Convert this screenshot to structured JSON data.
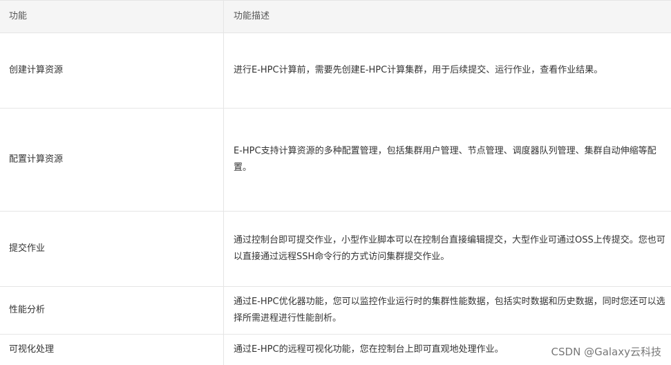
{
  "table": {
    "header": {
      "feature": "功能",
      "description": "功能描述"
    },
    "rows": [
      {
        "feature": "创建计算资源",
        "description": "进行E-HPC计算前，需要先创建E-HPC计算集群，用于后续提交、运行作业，查看作业结果。"
      },
      {
        "feature": "配置计算资源",
        "description": "E-HPC支持计算资源的多种配置管理，包括集群用户管理、节点管理、调度器队列管理、集群自动伸缩等配置。"
      },
      {
        "feature": "提交作业",
        "description": "通过控制台即可提交作业，小型作业脚本可以在控制台直接编辑提交，大型作业可通过OSS上传提交。您也可以直接通过远程SSH命令行的方式访问集群提交作业。"
      },
      {
        "feature": "性能分析",
        "description": "通过E-HPC优化器功能，您可以监控作业运行时的集群性能数据，包括实时数据和历史数据，同时您还可以选择所需进程进行性能剖析。"
      },
      {
        "feature": "可视化处理",
        "description": "通过E-HPC的远程可视化功能，您在控制台上即可直观地处理作业。"
      }
    ]
  },
  "watermark": "CSDN @Galaxy云科技"
}
